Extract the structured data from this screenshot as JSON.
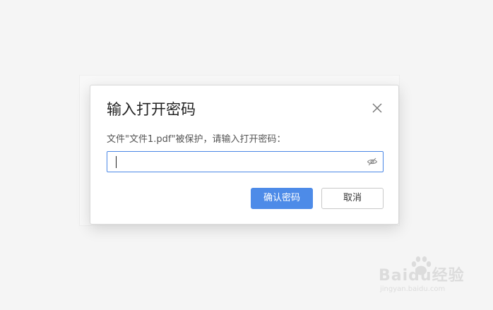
{
  "dialog": {
    "title": "输入打开密码",
    "prompt": "文件\"文件1.pdf\"被保护，请输入打开密码：",
    "password_value": "",
    "confirm_label": "确认密码",
    "cancel_label": "取消",
    "close_icon": "close-icon",
    "visibility_icon": "eye-hidden-icon"
  },
  "watermark": {
    "logo_text": "Baidu经验",
    "sub_text": "jingyan.baidu.com"
  },
  "colors": {
    "accent": "#4d8be8",
    "input_border": "#4a87e6",
    "background": "#f5f5f5"
  }
}
